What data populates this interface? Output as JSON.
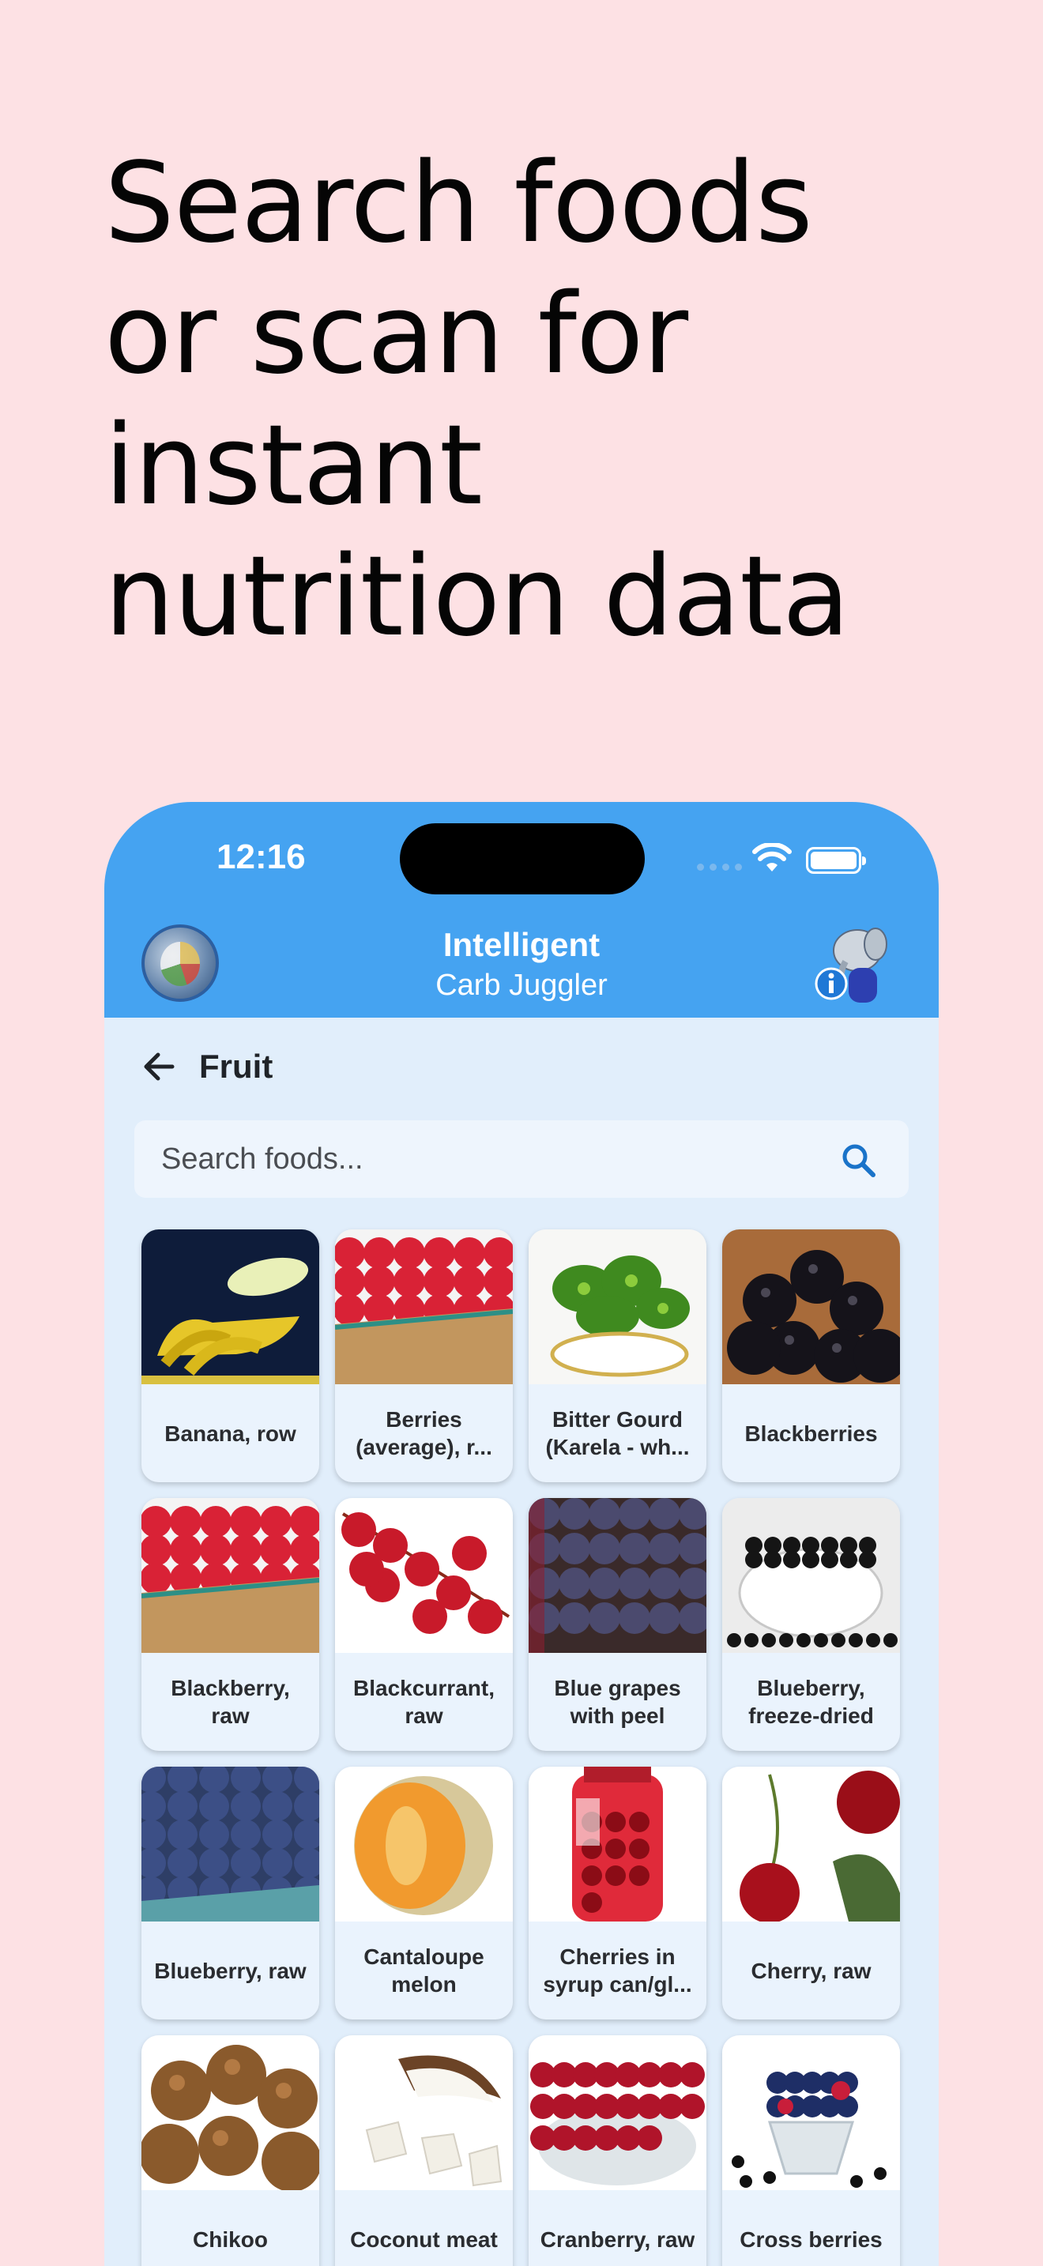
{
  "headline": [
    "Search foods",
    "or scan for",
    "instant",
    "nutrition data"
  ],
  "status_bar": {
    "time": "12:16"
  },
  "app": {
    "title_line1": "Intelligent",
    "title_line2": "Carb Juggler"
  },
  "nav": {
    "title": "Fruit"
  },
  "search": {
    "placeholder": "Search foods..."
  },
  "colors": {
    "appbar": "#45a3f1",
    "background": "#fde1e4",
    "screen": "#e1eefb",
    "accent": "#1a73c9"
  },
  "foods": [
    {
      "label": "Banana, row",
      "image": "banana"
    },
    {
      "label": "Berries (average), r...",
      "image": "raspberries-basket"
    },
    {
      "label": "Bitter Gourd (Karela - wh...",
      "image": "bitter-gourd"
    },
    {
      "label": "Blackberries",
      "image": "blackberries"
    },
    {
      "label": "Blackberry, raw",
      "image": "raspberries-basket"
    },
    {
      "label": "Blackcurrant, raw",
      "image": "redcurrant"
    },
    {
      "label": "Blue grapes with peel",
      "image": "blue-grapes"
    },
    {
      "label": "Blueberry, freeze-dried",
      "image": "dried-blueberries"
    },
    {
      "label": "Blueberry, raw",
      "image": "blueberries"
    },
    {
      "label": "Cantaloupe melon",
      "image": "cantaloupe"
    },
    {
      "label": "Cherries in syrup can/gl...",
      "image": "cherry-jar"
    },
    {
      "label": "Cherry, raw",
      "image": "cherry"
    },
    {
      "label": "Chikoo",
      "image": "chikoo"
    },
    {
      "label": "Coconut meat",
      "image": "coconut"
    },
    {
      "label": "Cranberry, raw",
      "image": "cranberries"
    },
    {
      "label": "Cross berries",
      "image": "cross-berries"
    }
  ]
}
